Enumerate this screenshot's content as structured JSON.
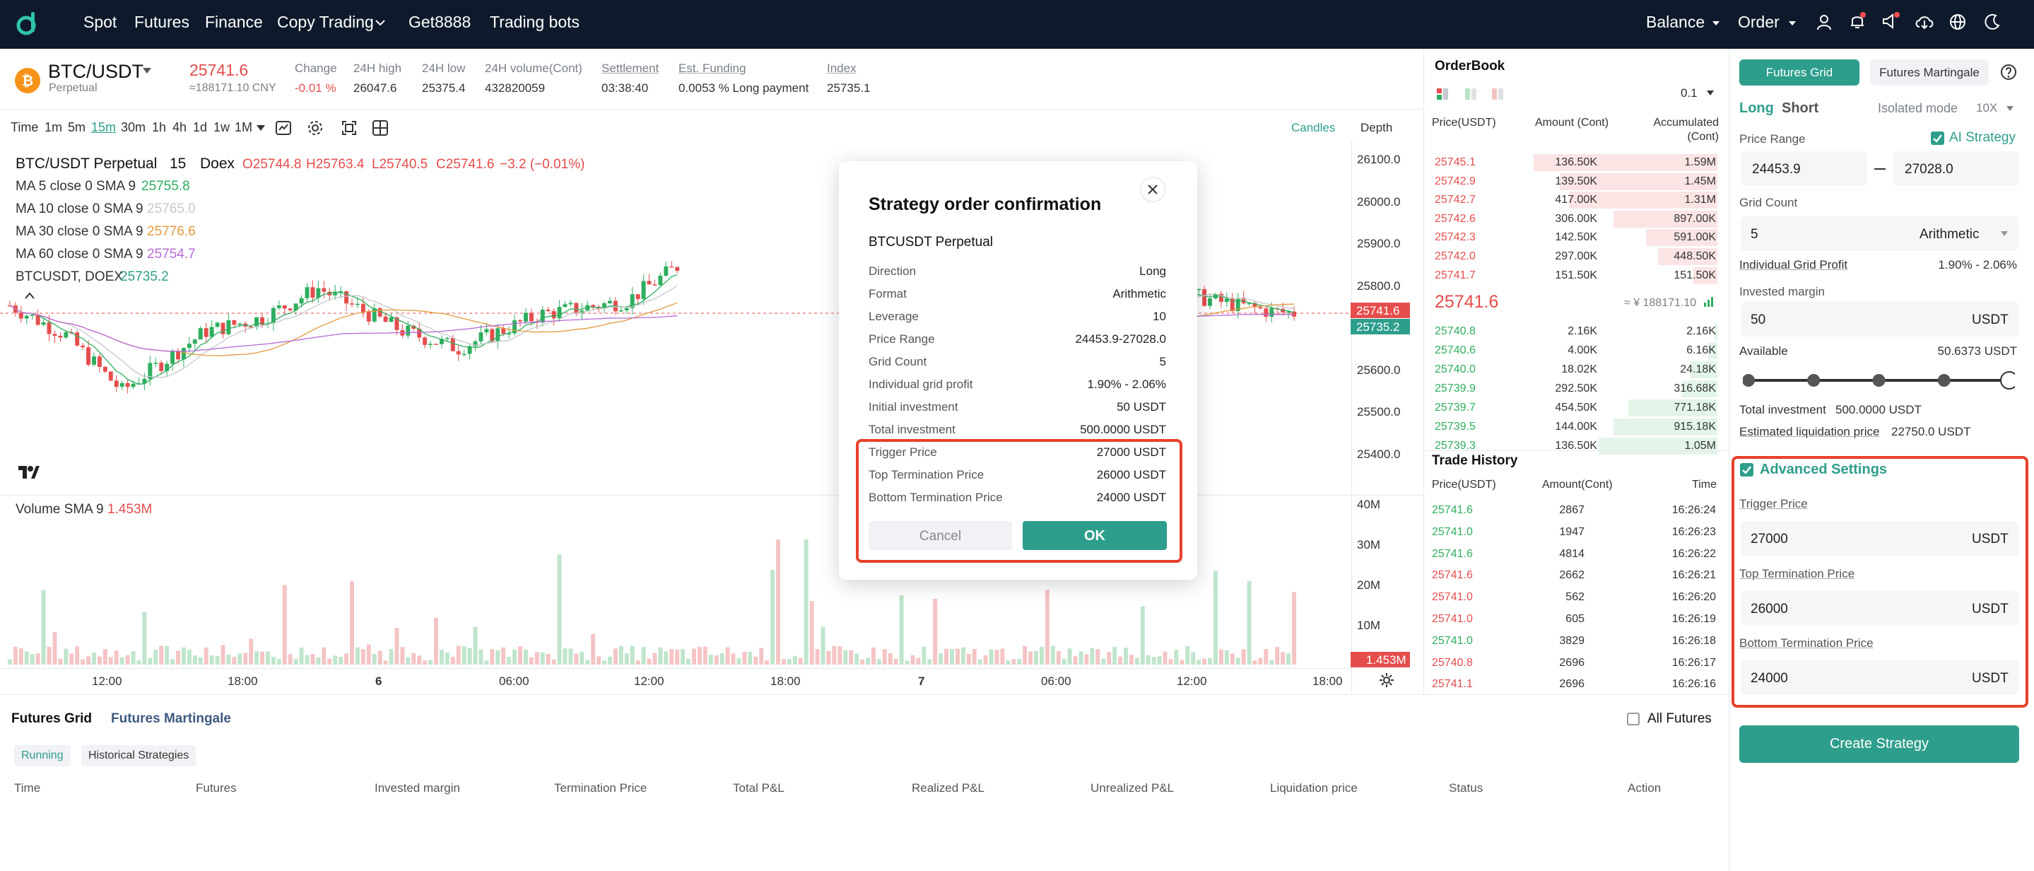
{
  "colors": {
    "nav_bg": "#0e1a2b",
    "accent": "#2e9e8c",
    "up": "#2eae5e",
    "down": "#e54d4d",
    "highlight": "#e8412c"
  },
  "nav": {
    "items": [
      "Spot",
      "Futures",
      "Finance",
      "Copy Trading",
      "Get8888",
      "Trading bots"
    ],
    "balance": "Balance",
    "order": "Order"
  },
  "ticker": {
    "pair": "BTC/USDT",
    "type": "Perpetual",
    "price": "25741.6",
    "cny": "≈188171.10 CNY",
    "stats": [
      {
        "label": "Change",
        "value": "-0.01 %"
      },
      {
        "label": "24H high",
        "value": "26047.6"
      },
      {
        "label": "24H low",
        "value": "25375.4"
      },
      {
        "label": "24H volume(Cont)",
        "value": "432820059"
      },
      {
        "label": "Settlement",
        "value": "03:38:40"
      },
      {
        "label": "Est. Funding",
        "value": "0.0053 % Long payment"
      },
      {
        "label": "Index",
        "value": "25735.1"
      }
    ]
  },
  "toolbar": {
    "timeframes": [
      "Time",
      "1m",
      "5m",
      "15m",
      "30m",
      "1h",
      "4h",
      "1d",
      "1w",
      "1M"
    ],
    "active": "15m",
    "candles": "Candles",
    "depth": "Depth"
  },
  "chart": {
    "title": "BTC/USDT Perpetual",
    "interval": "15",
    "exchange": "Doex",
    "o": "O25744.8",
    "h": "H25763.4",
    "l": "L25740.5",
    "c": "C25741.6",
    "chg": "−3.2 (−0.01%)",
    "mas": [
      {
        "label": "MA 5 close 0 SMA 9",
        "value": "25755.8",
        "color": "#2eae5e"
      },
      {
        "label": "MA 10 close 0 SMA 9",
        "value": "25765.0",
        "color": "#c5c8cc"
      },
      {
        "label": "MA 30 close 0 SMA 9",
        "value": "25776.6",
        "color": "#e39a3b"
      },
      {
        "label": "MA 60 close 0 SMA 9",
        "value": "25754.7",
        "color": "#b56ad8"
      }
    ],
    "index_label": "BTCUSDT, DOEX",
    "index_value": "25735.2",
    "price_ticks": [
      "26100.0",
      "26000.0",
      "25900.0",
      "25800.0",
      "25600.0",
      "25500.0",
      "25400.0"
    ],
    "price_tag": "25741.6",
    "index_tag": "25735.2",
    "volume_label": "Volume SMA 9",
    "volume_value": "1.453M",
    "vol_ticks": [
      "40M",
      "30M",
      "20M",
      "10M"
    ],
    "vol_tag": "1.453M",
    "time_ticks": [
      "12:00",
      "18:00",
      "6",
      "06:00",
      "12:00",
      "18:00",
      "7",
      "06:00",
      "12:00",
      "18:00"
    ]
  },
  "orderbook": {
    "title": "OrderBook",
    "precision": "0.1",
    "headers": {
      "price": "Price(USDT)",
      "amount": "Amount (Cont)",
      "acc1": "Accumulated",
      "acc2": "(Cont)"
    },
    "asks": [
      [
        "25745.1",
        "136.50K",
        "1.59M"
      ],
      [
        "25742.9",
        "139.50K",
        "1.45M"
      ],
      [
        "25742.7",
        "417.00K",
        "1.31M"
      ],
      [
        "25742.6",
        "306.00K",
        "897.00K"
      ],
      [
        "25742.3",
        "142.50K",
        "591.00K"
      ],
      [
        "25742.0",
        "297.00K",
        "448.50K"
      ],
      [
        "25741.7",
        "151.50K",
        "151.50K"
      ]
    ],
    "last": "25741.6",
    "last_cny": "≈ ¥ 188171.10",
    "bids": [
      [
        "25740.8",
        "2.16K",
        "2.16K"
      ],
      [
        "25740.6",
        "4.00K",
        "6.16K"
      ],
      [
        "25740.0",
        "18.02K",
        "24.18K"
      ],
      [
        "25739.9",
        "292.50K",
        "316.68K"
      ],
      [
        "25739.7",
        "454.50K",
        "771.18K"
      ],
      [
        "25739.5",
        "144.00K",
        "915.18K"
      ],
      [
        "25739.3",
        "136.50K",
        "1.05M"
      ]
    ]
  },
  "trades": {
    "title": "Trade History",
    "headers": [
      "Price(USDT)",
      "Amount(Cont)",
      "Time"
    ],
    "rows": [
      [
        "25741.6",
        "2867",
        "16:26:24",
        "up"
      ],
      [
        "25741.0",
        "1947",
        "16:26:23",
        "up"
      ],
      [
        "25741.6",
        "4814",
        "16:26:22",
        "up"
      ],
      [
        "25741.6",
        "2662",
        "16:26:21",
        "down"
      ],
      [
        "25741.0",
        "562",
        "16:26:20",
        "down"
      ],
      [
        "25741.0",
        "605",
        "16:26:19",
        "down"
      ],
      [
        "25741.0",
        "3829",
        "16:26:18",
        "up"
      ],
      [
        "25740.8",
        "2696",
        "16:26:17",
        "down"
      ],
      [
        "25741.1",
        "2696",
        "16:26:16",
        "down"
      ]
    ]
  },
  "bottom": {
    "tabs": [
      "Futures Grid",
      "Futures Martingale"
    ],
    "all_futures": "All Futures",
    "filters": [
      "Running",
      "Historical Strategies"
    ],
    "columns": [
      "Time",
      "Futures",
      "Invested margin",
      "Termination Price",
      "Total P&L",
      "Realized P&L",
      "Unrealized P&L",
      "Liquidation price",
      "Status",
      "Action"
    ]
  },
  "panel": {
    "tabs": [
      "Futures Grid",
      "Futures Martingale"
    ],
    "long": "Long",
    "short": "Short",
    "mode": "Isolated mode",
    "leverage": "10X",
    "ai": "AI Strategy",
    "price_range_label": "Price Range",
    "range_low": "24453.9",
    "range_high": "27028.0",
    "grid_count_label": "Grid Count",
    "grid_count": "5",
    "grid_type": "Arithmetic",
    "igp_label": "Individual Grid Profit",
    "igp_value": "1.90% - 2.06%",
    "margin_label": "Invested margin",
    "margin": "50",
    "unit": "USDT",
    "available_label": "Available",
    "available_value": "50.6373 USDT",
    "slider_pct": 100,
    "total_label": "Total investment",
    "total_value": "500.0000 USDT",
    "liq_label": "Estimated liquidation price",
    "liq_value": "22750.0 USDT",
    "adv_label": "Advanced Settings",
    "trigger_label": "Trigger Price",
    "trigger": "27000",
    "top_label": "Top Termination Price",
    "top": "26000",
    "bottom_label": "Bottom Termination Price",
    "bottom": "24000",
    "create": "Create Strategy"
  },
  "modal": {
    "title": "Strategy order confirmation",
    "pair": "BTCUSDT Perpetual",
    "rows": [
      [
        "Direction",
        "Long"
      ],
      [
        "Format",
        "Arithmetic"
      ],
      [
        "Leverage",
        "10"
      ],
      [
        "Price Range",
        "24453.9-27028.0"
      ],
      [
        "Grid Count",
        "5"
      ],
      [
        "Individual grid profit",
        "1.90% - 2.06%"
      ],
      [
        "Initial investment",
        "50 USDT"
      ],
      [
        "Total investment",
        "500.0000 USDT"
      ]
    ],
    "adv_rows": [
      [
        "Trigger Price",
        "27000 USDT"
      ],
      [
        "Top Termination Price",
        "26000 USDT"
      ],
      [
        "Bottom Termination Price",
        "24000 USDT"
      ]
    ],
    "cancel": "Cancel",
    "ok": "OK"
  }
}
